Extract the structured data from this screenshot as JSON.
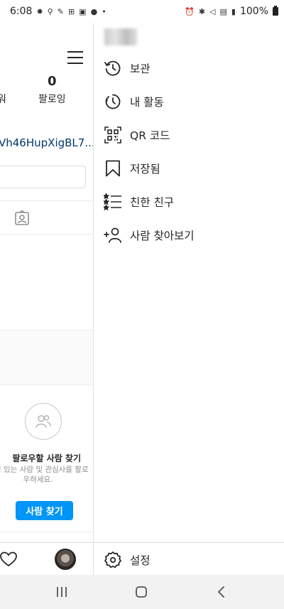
{
  "status_bar": {
    "time": "6:08",
    "battery": "100%"
  },
  "profile": {
    "following_count": "0",
    "following_label": "팔로잉",
    "followers_label_fragment": "워",
    "bio_link": "Vh46HupXigBL7...",
    "find_people": {
      "title": "팔로우할 사람 찾기",
      "description": "관심 있는 사람 및 관심사를 팔로우하세요.",
      "button_label": "사람 찾기"
    }
  },
  "drawer": {
    "items": [
      {
        "label": "보관",
        "icon": "archive-icon"
      },
      {
        "label": "내 활동",
        "icon": "activity-icon"
      },
      {
        "label": "QR 코드",
        "icon": "qr-code-icon"
      },
      {
        "label": "저장됨",
        "icon": "bookmark-icon"
      },
      {
        "label": "친한 친구",
        "icon": "close-friends-icon"
      },
      {
        "label": "사람 찾아보기",
        "icon": "add-person-icon"
      }
    ],
    "settings_label": "설정"
  },
  "colors": {
    "accent": "#0095f6",
    "link": "#00376b",
    "text": "#262626"
  }
}
